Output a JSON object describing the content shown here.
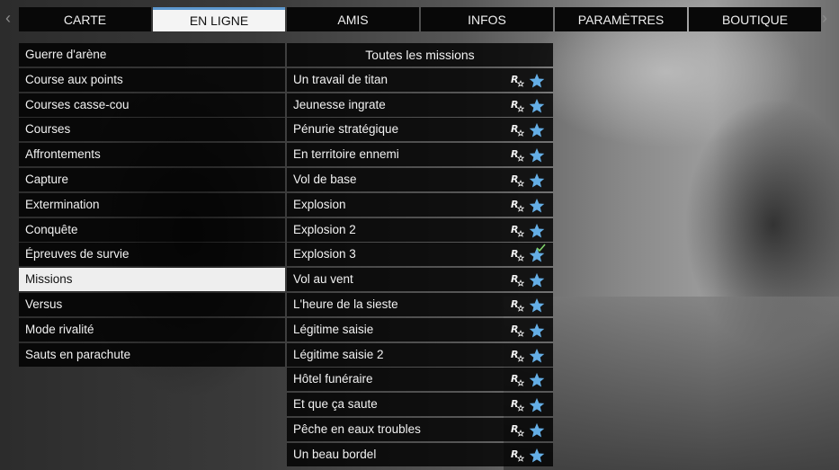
{
  "nav": {
    "prev_arrow": "‹",
    "next_arrow": "›",
    "tabs": [
      {
        "label": "CARTE"
      },
      {
        "label": "EN LIGNE"
      },
      {
        "label": "AMIS"
      },
      {
        "label": "INFOS"
      },
      {
        "label": "PARAMÈTRES"
      },
      {
        "label": "BOUTIQUE"
      }
    ],
    "active_tab": "EN LIGNE",
    "accent_color": "#5d98cf"
  },
  "categories": {
    "items": [
      {
        "label": "Guerre d'arène"
      },
      {
        "label": "Course aux points"
      },
      {
        "label": "Courses casse-cou"
      },
      {
        "label": "Courses"
      },
      {
        "label": "Affrontements"
      },
      {
        "label": "Capture"
      },
      {
        "label": "Extermination"
      },
      {
        "label": "Conquête"
      },
      {
        "label": "Épreuves de survie"
      },
      {
        "label": "Missions"
      },
      {
        "label": "Versus"
      },
      {
        "label": "Mode rivalité"
      },
      {
        "label": "Sauts en parachute"
      }
    ],
    "selected": "Missions"
  },
  "missions": {
    "header": "Toutes les missions",
    "star_color": "#64aee6",
    "check_color": "#7fd36a",
    "items": [
      {
        "label": "Un travail de titan",
        "icons": [
          "rockstar-verified-icon",
          "star-icon"
        ],
        "completed": false
      },
      {
        "label": "Jeunesse ingrate",
        "icons": [
          "rockstar-verified-icon",
          "star-icon"
        ],
        "completed": false
      },
      {
        "label": "Pénurie stratégique",
        "icons": [
          "rockstar-verified-icon",
          "star-icon"
        ],
        "completed": false
      },
      {
        "label": "En territoire ennemi",
        "icons": [
          "rockstar-verified-icon",
          "star-icon"
        ],
        "completed": false
      },
      {
        "label": "Vol de base",
        "icons": [
          "rockstar-verified-icon",
          "star-icon"
        ],
        "completed": false
      },
      {
        "label": "Explosion",
        "icons": [
          "rockstar-verified-icon",
          "star-icon"
        ],
        "completed": false
      },
      {
        "label": "Explosion 2",
        "icons": [
          "rockstar-verified-icon",
          "star-icon"
        ],
        "completed": false
      },
      {
        "label": "Explosion 3",
        "icons": [
          "rockstar-verified-icon",
          "star-icon",
          "check-icon"
        ],
        "completed": true
      },
      {
        "label": "Vol au vent",
        "icons": [
          "rockstar-verified-icon",
          "star-icon"
        ],
        "completed": false
      },
      {
        "label": "L'heure de la sieste",
        "icons": [
          "rockstar-verified-icon",
          "star-icon"
        ],
        "completed": false
      },
      {
        "label": "Légitime saisie",
        "icons": [
          "rockstar-verified-icon",
          "star-icon"
        ],
        "completed": false
      },
      {
        "label": "Légitime saisie 2",
        "icons": [
          "rockstar-verified-icon",
          "star-icon"
        ],
        "completed": false
      },
      {
        "label": "Hôtel funéraire",
        "icons": [
          "rockstar-verified-icon",
          "star-icon"
        ],
        "completed": false
      },
      {
        "label": "Et que ça saute",
        "icons": [
          "rockstar-verified-icon",
          "star-icon"
        ],
        "completed": false
      },
      {
        "label": "Pêche en eaux troubles",
        "icons": [
          "rockstar-verified-icon",
          "star-icon"
        ],
        "completed": false
      },
      {
        "label": "Un beau bordel",
        "icons": [
          "rockstar-verified-icon",
          "star-icon"
        ],
        "completed": false
      }
    ]
  }
}
